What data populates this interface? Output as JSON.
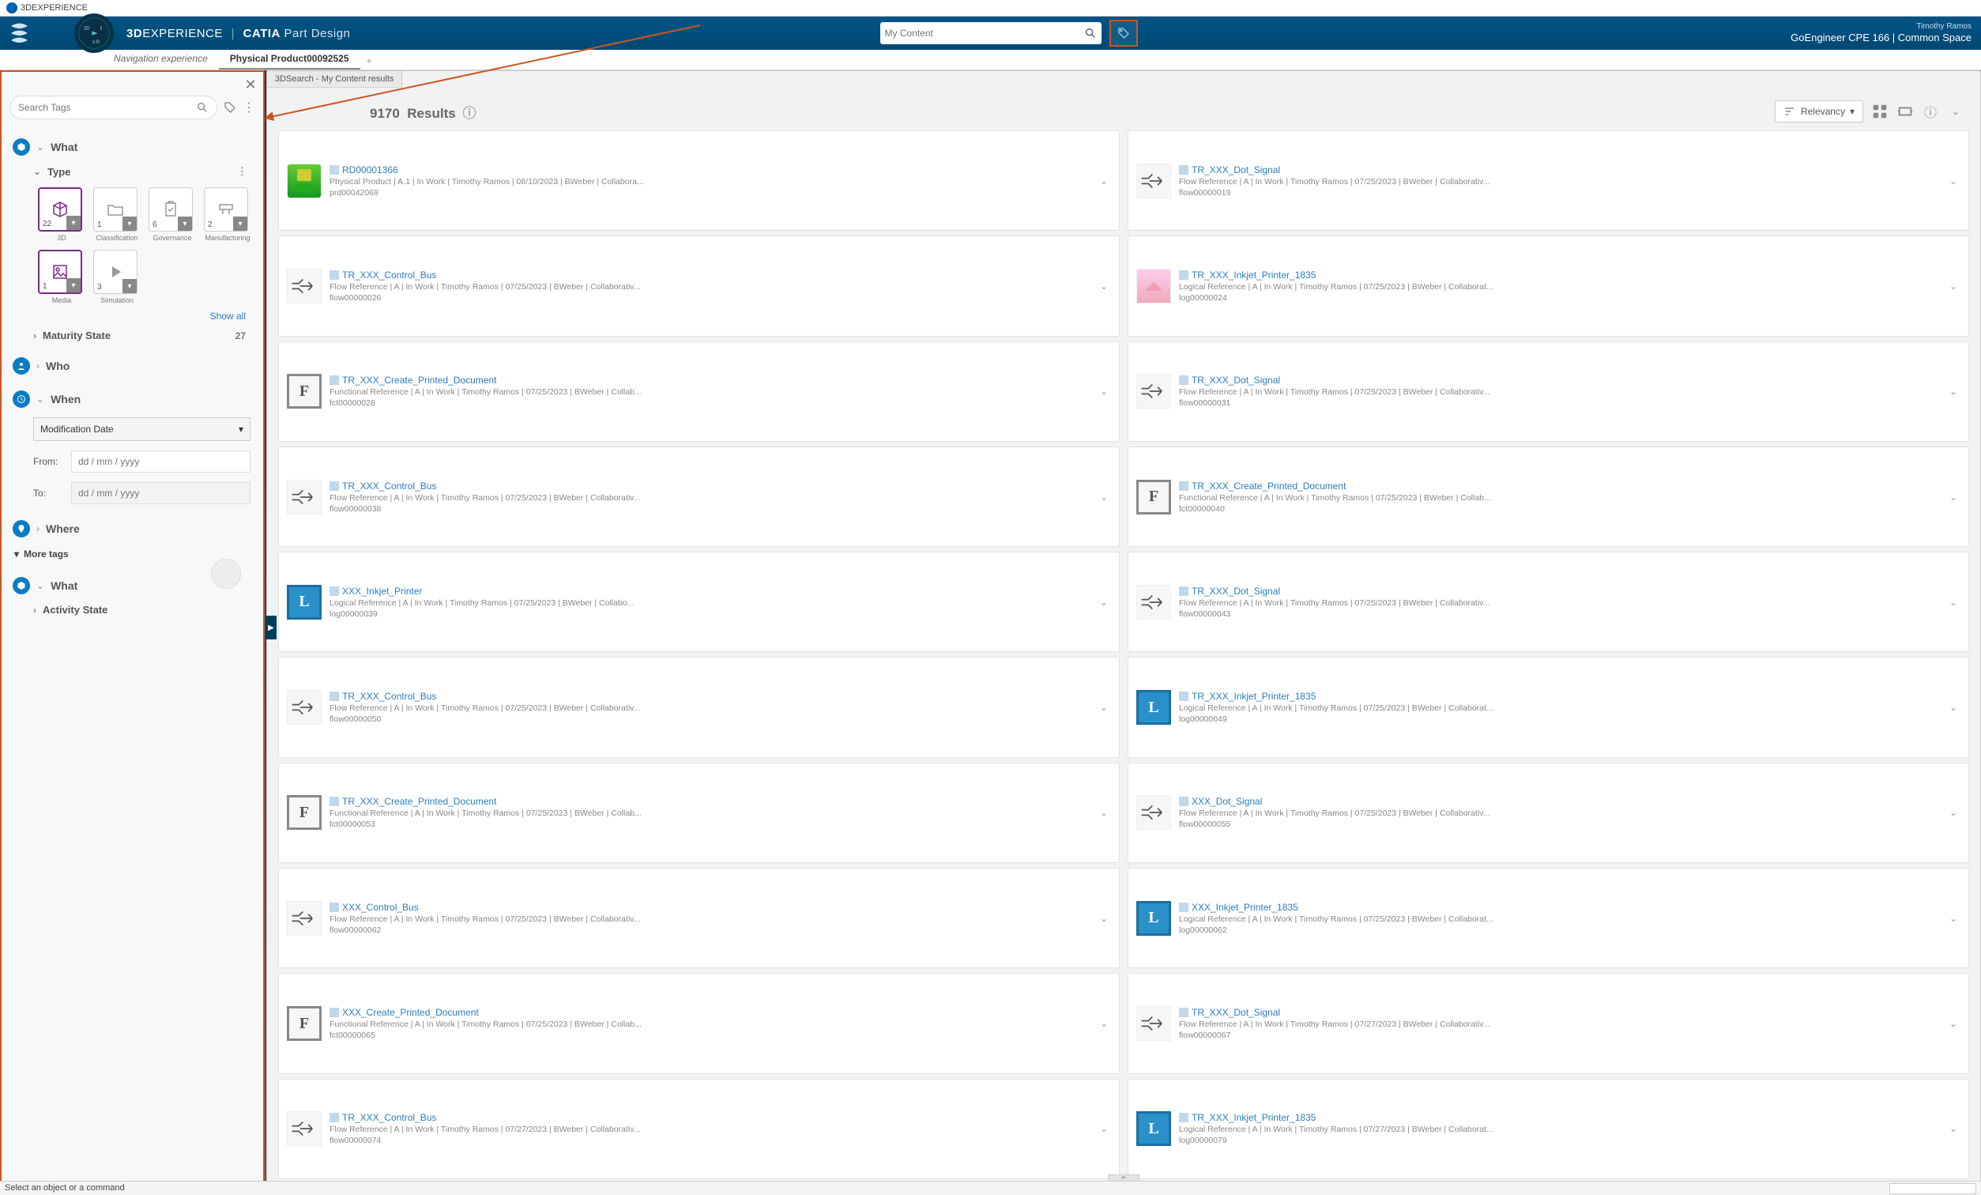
{
  "window_title": "3DEXPERIENCE",
  "brand": {
    "threeD": "3D",
    "exp": "EXPERIENCE",
    "app": "CATIA",
    "sub": "Part Design"
  },
  "search_placeholder": "My Content",
  "user": {
    "name": "Timothy Ramos",
    "space": "GoEngineer CPE 166 | Common Space"
  },
  "tabs": [
    {
      "label": "Navigation experience",
      "active": false
    },
    {
      "label": "Physical Product00092525",
      "active": true
    }
  ],
  "content_tab": "3DSearch - My Content results",
  "results_count": "9170",
  "results_label": "Results",
  "sort_label": "Relevancy",
  "sixw": {
    "search_placeholder": "Search Tags",
    "what": "What",
    "type": "Type",
    "types": [
      {
        "label": "3D",
        "count": "22",
        "selected": true,
        "icon": "cube"
      },
      {
        "label": "Classification",
        "count": "1",
        "icon": "folder"
      },
      {
        "label": "Governance",
        "count": "6",
        "icon": "clipboard"
      },
      {
        "label": "Manufacturing",
        "count": "2",
        "icon": "factory"
      },
      {
        "label": "Media",
        "count": "1",
        "selected": true,
        "icon": "image"
      },
      {
        "label": "Simulation",
        "count": "3",
        "icon": "play"
      }
    ],
    "show_all": "Show all",
    "maturity": "Maturity State",
    "maturity_count": "27",
    "who": "Who",
    "when": "When",
    "when_select": "Modification Date",
    "from": "From:",
    "to": "To:",
    "date_placeholder": "dd / mm / yyyy",
    "where": "Where",
    "more_tags": "More tags",
    "what2": "What",
    "activity_state": "Activity State"
  },
  "results": [
    {
      "thumb": "prod",
      "title": "RD00001366",
      "meta": "Physical Product | A.1 | In Work | Timothy Ramos | 08/10/2023 | BWeber | Collabora...",
      "id": "prd00042069"
    },
    {
      "thumb": "flow",
      "title": "TR_XXX_Dot_Signal",
      "meta": "Flow Reference | A | In Work | Timothy Ramos | 07/25/2023 | BWeber | Collaborativ...",
      "id": "flow00000019"
    },
    {
      "thumb": "flow",
      "title": "TR_XXX_Control_Bus",
      "meta": "Flow Reference | A | In Work | Timothy Ramos | 07/25/2023 | BWeber | Collaborativ...",
      "id": "flow00000026"
    },
    {
      "thumb": "pink",
      "title": "TR_XXX_Inkjet_Printer_1835",
      "meta": "Logical Reference | A | In Work | Timothy Ramos | 07/25/2023 | BWeber | Collaborat...",
      "id": "log00000024"
    },
    {
      "thumb": "F",
      "title": "TR_XXX_Create_Printed_Document",
      "meta": "Functional Reference | A | In Work | Timothy Ramos | 07/25/2023 | BWeber | Collab...",
      "id": "fct00000028"
    },
    {
      "thumb": "flow",
      "title": "TR_XXX_Dot_Signal",
      "meta": "Flow Reference | A | In Work | Timothy Ramos | 07/25/2023 | BWeber | Collaborativ...",
      "id": "flow00000031"
    },
    {
      "thumb": "flow",
      "title": "TR_XXX_Control_Bus",
      "meta": "Flow Reference | A | In Work | Timothy Ramos | 07/25/2023 | BWeber | Collaborativ...",
      "id": "flow00000038"
    },
    {
      "thumb": "F",
      "title": "TR_XXX_Create_Printed_Document",
      "meta": "Functional Reference | A | In Work | Timothy Ramos | 07/25/2023 | BWeber | Collab...",
      "id": "fct00000040"
    },
    {
      "thumb": "L",
      "title": "XXX_Inkjet_Printer",
      "meta": "Logical Reference | A | In Work | Timothy Ramos | 07/25/2023 | BWeber | Collabo...",
      "id": "log00000039"
    },
    {
      "thumb": "flow",
      "title": "TR_XXX_Dot_Signal",
      "meta": "Flow Reference | A | In Work | Timothy Ramos | 07/25/2023 | BWeber | Collaborativ...",
      "id": "flow00000043"
    },
    {
      "thumb": "flow",
      "title": "TR_XXX_Control_Bus",
      "meta": "Flow Reference | A | In Work | Timothy Ramos | 07/25/2023 | BWeber | Collaborativ...",
      "id": "flow00000050"
    },
    {
      "thumb": "L",
      "title": "TR_XXX_Inkjet_Printer_1835",
      "meta": "Logical Reference | A | In Work | Timothy Ramos | 07/25/2023 | BWeber | Collaborat...",
      "id": "log00000049"
    },
    {
      "thumb": "F",
      "title": "TR_XXX_Create_Printed_Document",
      "meta": "Functional Reference | A | In Work | Timothy Ramos | 07/25/2023 | BWeber | Collab...",
      "id": "fct00000053"
    },
    {
      "thumb": "flow",
      "title": "XXX_Dot_Signal",
      "meta": "Flow Reference | A | In Work | Timothy Ramos | 07/25/2023 | BWeber | Collaborativ...",
      "id": "flow00000055"
    },
    {
      "thumb": "flow",
      "title": "XXX_Control_Bus",
      "meta": "Flow Reference | A | In Work | Timothy Ramos | 07/25/2023 | BWeber | Collaborativ...",
      "id": "flow00000062"
    },
    {
      "thumb": "L",
      "title": "XXX_Inkjet_Printer_1835",
      "meta": "Logical Reference | A | In Work | Timothy Ramos | 07/25/2023 | BWeber | Collaborat...",
      "id": "log00000062"
    },
    {
      "thumb": "F",
      "title": "XXX_Create_Printed_Document",
      "meta": "Functional Reference | A | In Work | Timothy Ramos | 07/25/2023 | BWeber | Collab...",
      "id": "fct00000065"
    },
    {
      "thumb": "flow",
      "title": "TR_XXX_Dot_Signal",
      "meta": "Flow Reference | A | In Work | Timothy Ramos | 07/27/2023 | BWeber | Collaborativ...",
      "id": "flow00000067"
    },
    {
      "thumb": "flow",
      "title": "TR_XXX_Control_Bus",
      "meta": "Flow Reference | A | In Work | Timothy Ramos | 07/27/2023 | BWeber | Collaborativ...",
      "id": "flow00000074"
    },
    {
      "thumb": "L",
      "title": "TR_XXX_Inkjet_Printer_1835",
      "meta": "Logical Reference | A | In Work | Timothy Ramos | 07/27/2023 | BWeber | Collaborat...",
      "id": "log00000079"
    }
  ],
  "statusbar": "Select an object or a command"
}
